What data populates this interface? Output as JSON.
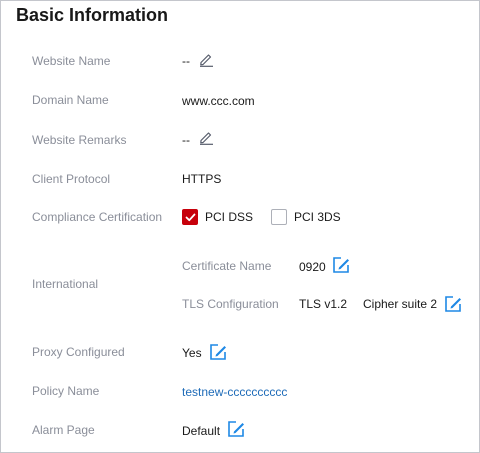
{
  "title": "Basic Information",
  "website_name": {
    "label": "Website Name",
    "value": "--",
    "icon": "edit-pencil-icon"
  },
  "domain_name": {
    "label": "Domain Name",
    "value": "www.ccc.com"
  },
  "website_remarks": {
    "label": "Website Remarks",
    "value": "--",
    "icon": "edit-pencil-icon"
  },
  "client_protocol": {
    "label": "Client Protocol",
    "value": "HTTPS"
  },
  "compliance": {
    "label": "Compliance Certification",
    "options": [
      {
        "label": "PCI DSS",
        "checked": true
      },
      {
        "label": "PCI 3DS",
        "checked": false
      }
    ]
  },
  "international": {
    "label": "International",
    "certificate": {
      "label": "Certificate Name",
      "value": "0920",
      "icon": "edit-box-icon"
    },
    "tls": {
      "label": "TLS Configuration",
      "version": "TLS v1.2",
      "cipher": "Cipher suite 2",
      "icon": "edit-box-icon"
    }
  },
  "proxy": {
    "label": "Proxy Configured",
    "value": "Yes",
    "icon": "edit-box-icon"
  },
  "policy": {
    "label": "Policy Name",
    "value": "testnew-cccccccccc"
  },
  "alarm": {
    "label": "Alarm Page",
    "value": "Default",
    "icon": "edit-box-icon"
  },
  "colors": {
    "accent": "#c7000b",
    "link": "#1e6bb8",
    "icon_blue": "#1e88e5",
    "label_gray": "#8a8e99"
  }
}
